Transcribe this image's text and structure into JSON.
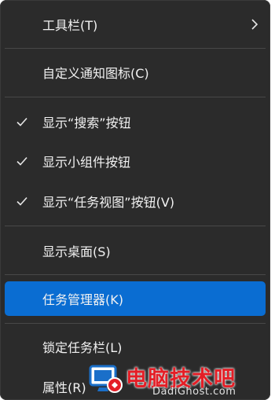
{
  "menu": {
    "items": [
      {
        "label": "工具栏(T)",
        "checked": false,
        "has_submenu": true
      },
      {
        "label": "自定义通知图标(C)",
        "checked": false,
        "has_submenu": false
      },
      {
        "label": "显示“搜索”按钮",
        "checked": true,
        "has_submenu": false
      },
      {
        "label": "显示小组件按钮",
        "checked": true,
        "has_submenu": false
      },
      {
        "label": "显示“任务视图”按钮(V)",
        "checked": true,
        "has_submenu": false
      },
      {
        "label": "显示桌面(S)",
        "checked": false,
        "has_submenu": false
      },
      {
        "label": "任务管理器(K)",
        "checked": false,
        "has_submenu": false,
        "highlighted": true
      },
      {
        "label": "锁定任务栏(L)",
        "checked": false,
        "has_submenu": false
      },
      {
        "label": "属性(R)",
        "checked": false,
        "has_submenu": false
      }
    ]
  },
  "watermark": {
    "text": "电脑技术吧",
    "url": "DadiGhost.com"
  },
  "colors": {
    "menu_background": "#2b2b2b",
    "highlight": "#0a6dd2",
    "separator": "#484848",
    "text": "#f2f2f2",
    "watermark_red": "#e41e26"
  },
  "icons": {
    "check": "checkmark-icon",
    "submenu": "chevron-right-icon",
    "watermark_logo": "monitor-logo-icon"
  }
}
